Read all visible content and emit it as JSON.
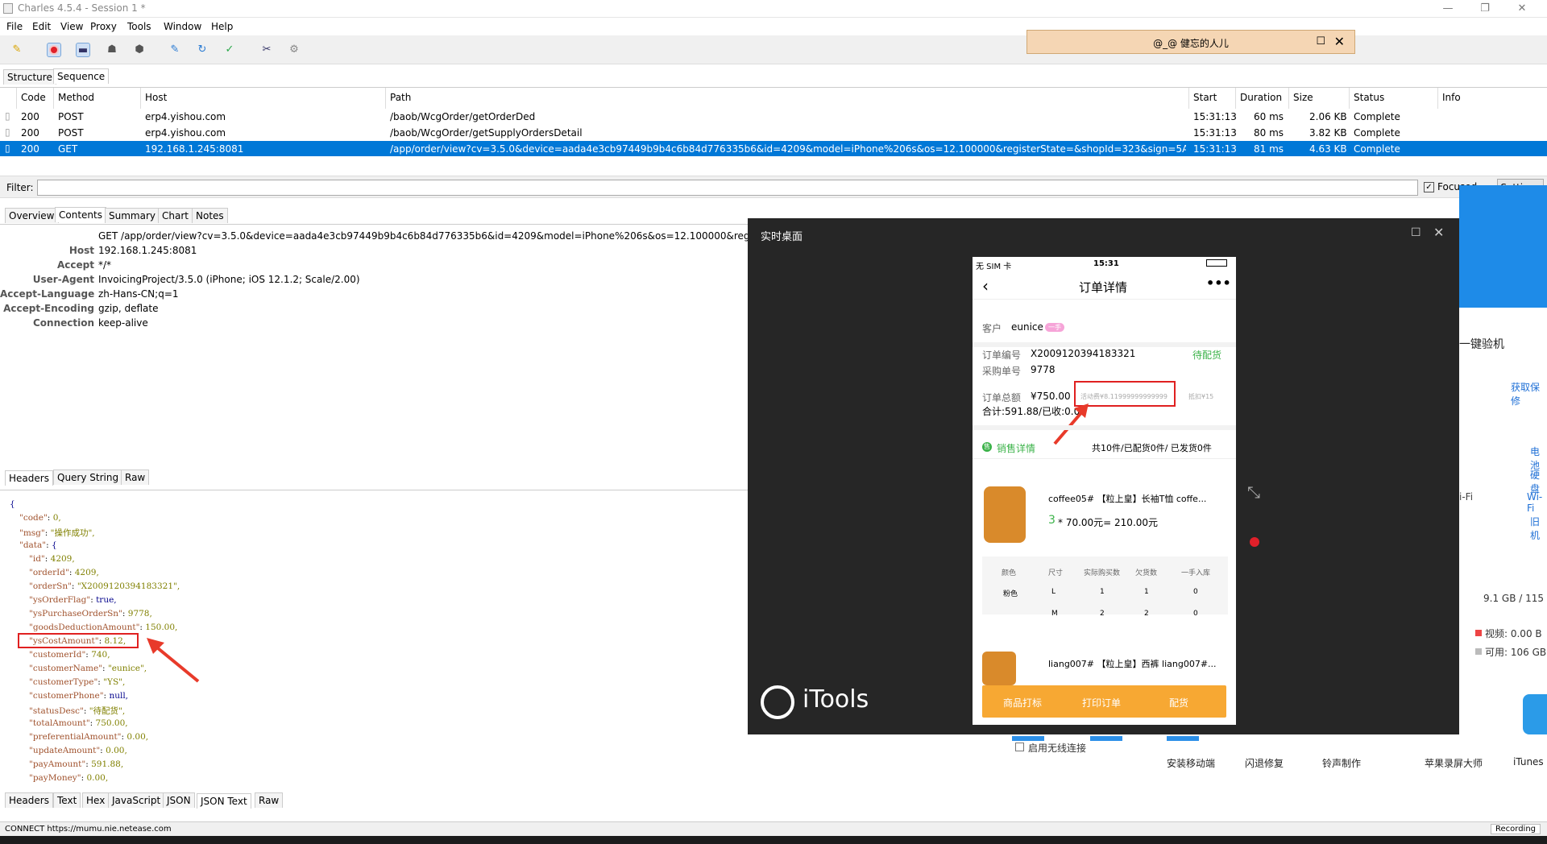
{
  "window": {
    "title": "Charles 4.5.4 - Session 1 *"
  },
  "menu": [
    "File",
    "Edit",
    "View",
    "Proxy",
    "Tools",
    "Window",
    "Help"
  ],
  "floating_window": {
    "title": "@_@  健忘的人儿"
  },
  "view_tabs": [
    "Structure",
    "Sequence"
  ],
  "table": {
    "headers": [
      "Code",
      "Method",
      "Host",
      "Path",
      "Start",
      "Duration",
      "Size",
      "Status",
      "Info"
    ],
    "rows": [
      {
        "code": "200",
        "method": "POST",
        "host": "erp4.yishou.com",
        "path": "/baob/WcgOrder/getOrderDed",
        "start": "15:31:13",
        "duration": "60 ms",
        "size": "2.06 KB",
        "status": "Complete"
      },
      {
        "code": "200",
        "method": "POST",
        "host": "erp4.yishou.com",
        "path": "/baob/WcgOrder/getSupplyOrdersDetail",
        "start": "15:31:13",
        "duration": "80 ms",
        "size": "3.82 KB",
        "status": "Complete"
      },
      {
        "code": "200",
        "method": "GET",
        "host": "192.168.1.245:8081",
        "path": "/app/order/view?cv=3.5.0&device=aada4e3cb97449b9b4c6b84d776335b6&id=4209&model=iPhone%206s&os=12.100000&registerState=&shopId=323&sign=5AAB7...",
        "start": "15:31:13",
        "duration": "81 ms",
        "size": "4.63 KB",
        "status": "Complete"
      }
    ]
  },
  "filter": {
    "label": "Filter:",
    "value": "",
    "focused_label": "Focused",
    "settings_label": "Settings"
  },
  "detail_tabs": [
    "Overview",
    "Contents",
    "Summary",
    "Chart",
    "Notes"
  ],
  "request": {
    "request_line": "GET /app/order/view?cv=3.5.0&device=aada4e3cb97449b9b4c6b84d776335b6&id=4209&model=iPhone%206s&os=12.100000&registerS",
    "headers": [
      {
        "name": "Host",
        "value": "192.168.1.245:8081"
      },
      {
        "name": "Accept",
        "value": "*/*"
      },
      {
        "name": "User-Agent",
        "value": "InvoicingProject/3.5.0 (iPhone; iOS 12.1.2; Scale/2.00)"
      },
      {
        "name": "Accept-Language",
        "value": "zh-Hans-CN;q=1"
      },
      {
        "name": "Accept-Encoding",
        "value": "gzip, deflate"
      },
      {
        "name": "Connection",
        "value": "keep-alive"
      }
    ]
  },
  "request_tabs": [
    "Headers",
    "Query String",
    "Raw"
  ],
  "response_json_lines": [
    {
      "k": "",
      "v": "{"
    },
    {
      "k": "\"code\"",
      "v": "0,"
    },
    {
      "k": "\"msg\"",
      "v": "\"操作成功\","
    },
    {
      "k": "\"data\"",
      "v": "{"
    },
    {
      "k": "\"id\"",
      "v": "4209,"
    },
    {
      "k": "\"orderId\"",
      "v": "4209,"
    },
    {
      "k": "\"orderSn\"",
      "v": "\"X2009120394183321\","
    },
    {
      "k": "\"ysOrderFlag\"",
      "v": "true,"
    },
    {
      "k": "\"ysPurchaseOrderSn\"",
      "v": "9778,"
    },
    {
      "k": "\"goodsDeductionAmount\"",
      "v": "150.00,"
    },
    {
      "k": "\"ysCostAmount\"",
      "v": "8.12,"
    },
    {
      "k": "\"customerId\"",
      "v": "740,"
    },
    {
      "k": "\"customerName\"",
      "v": "\"eunice\","
    },
    {
      "k": "\"customerType\"",
      "v": "\"YS\","
    },
    {
      "k": "\"customerPhone\"",
      "v": "null,"
    },
    {
      "k": "\"statusDesc\"",
      "v": "\"待配货\","
    },
    {
      "k": "\"totalAmount\"",
      "v": "750.00,"
    },
    {
      "k": "\"preferentialAmount\"",
      "v": "0.00,"
    },
    {
      "k": "\"updateAmount\"",
      "v": "0.00,"
    },
    {
      "k": "\"payAmount\"",
      "v": "591.88,"
    },
    {
      "k": "\"payMoney\"",
      "v": "0.00,"
    }
  ],
  "response_tabs": [
    "Headers",
    "Text",
    "Hex",
    "JavaScript",
    "JSON",
    "JSON Text",
    "Raw"
  ],
  "status_bar": {
    "text": "CONNECT https://mumu.nie.netease.com",
    "recording": "Recording"
  },
  "itools": {
    "title": "实时桌面",
    "logo": "iTools",
    "phone": {
      "carrier": "无 SIM 卡",
      "time": "15:31",
      "page_title": "订单详情",
      "customer_label": "客户",
      "customer_name": "eunice",
      "customer_tag": "一手",
      "order_no_label": "订单编号",
      "order_no": "X2009120394183321",
      "order_status": "待配货",
      "purchase_no_label": "采购单号",
      "purchase_no": "9778",
      "total_label": "订单总额",
      "total": "¥750.00",
      "activity_fee": "活动费¥8.11999999999999",
      "deduct": "抵扣¥15",
      "sum_line": "合计:591.88/已收:0.00",
      "sales_label": "销售详情",
      "sales_summary": "共10件/已配货0件/ 已发货0件",
      "item1_name": "coffee05# 【粒上皇】长袖T恤  coffe...",
      "item1_qty": "3",
      "item1_price": "* 70.00元= 210.00元",
      "size_table_headers": [
        "颜色",
        "尺寸",
        "实际购买数",
        "欠货数",
        "一手入库"
      ],
      "size_rows": [
        [
          "粉色",
          "L",
          "1",
          "1",
          "0"
        ],
        [
          "",
          "M",
          "2",
          "2",
          "0"
        ]
      ],
      "item2_name": "liang007# 【粒上皇】西裤  liang007#...",
      "actions": [
        "商品打标",
        "打印订单",
        "配货"
      ]
    }
  },
  "right_app": {
    "heading": "一键验机",
    "link": "获取保修",
    "items": [
      "电池",
      "硬盘",
      "Wi-Fi",
      "旧机"
    ],
    "wifi_left": "i-Fi",
    "storage": "9.1 GB / 115",
    "video": "视频: 0.00 B",
    "available": "可用: 106 GB",
    "bottom_tools": [
      "安装移动端",
      "闪退修复",
      "铃声制作",
      "苹果录屏大师",
      "iTunes"
    ],
    "checkbox_label": "启用无线连接"
  }
}
